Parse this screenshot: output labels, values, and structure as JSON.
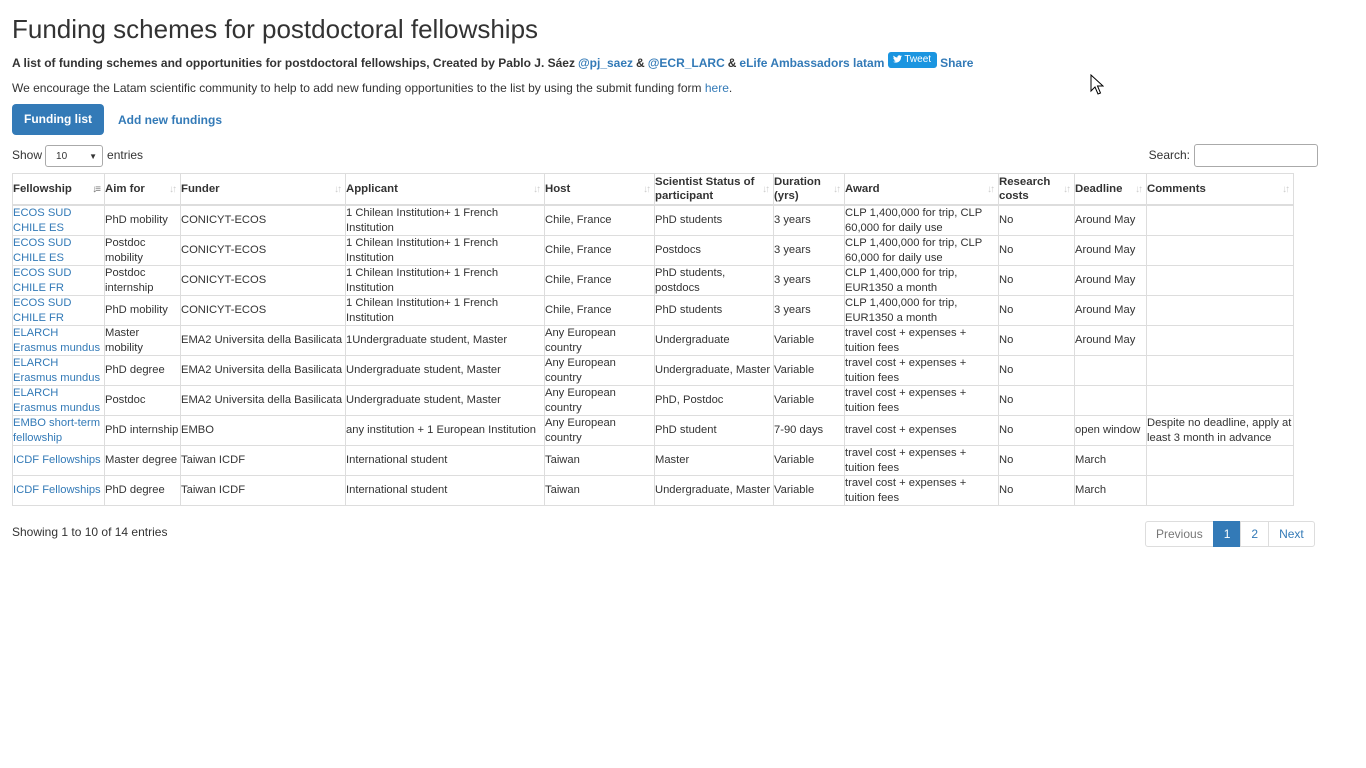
{
  "page": {
    "title": "Funding schemes for postdoctoral fellowships",
    "subtitle_text": "A list of funding schemes and opportunities for postdoctoral fellowships, Created by Pablo J. Sáez",
    "link_pj": "@pj_saez",
    "amp1": "&",
    "link_ecr": "@ECR_LARC",
    "amp2": "&",
    "link_elife": "eLife Ambassadors latam",
    "tweet_label": "Tweet",
    "share_label": "Share",
    "encourage_text": "We encourage the Latam scientific community to help to add new funding opportunities to the list by using the submit funding form",
    "encourage_link": "here",
    "encourage_end": "."
  },
  "tabs": {
    "active": "Funding list",
    "other": "Add new fundings"
  },
  "controls": {
    "show_label": "Show",
    "entries_value": "10",
    "entries_label": "entries",
    "search_label": "Search:"
  },
  "table": {
    "headers": [
      "Fellowship",
      "Aim for",
      "Funder",
      "Applicant",
      "Host",
      "Scientist Status of participant",
      "Duration (yrs)",
      "Award",
      "Research costs",
      "Deadline",
      "Comments"
    ],
    "rows": [
      [
        "ECOS SUD CHILE ES",
        "PhD mobility",
        "CONICYT-ECOS",
        "1 Chilean Institution+ 1 French Institution",
        "Chile, France",
        "PhD students",
        "3 years",
        "CLP 1,400,000 for trip, CLP 60,000 for daily use",
        "No",
        "Around May",
        ""
      ],
      [
        "ECOS SUD CHILE ES",
        "Postdoc mobility",
        "CONICYT-ECOS",
        "1 Chilean Institution+ 1 French Institution",
        "Chile, France",
        "Postdocs",
        "3 years",
        "CLP 1,400,000 for trip, CLP 60,000 for daily use",
        "No",
        "Around May",
        ""
      ],
      [
        "ECOS SUD CHILE FR",
        "Postdoc internship",
        "CONICYT-ECOS",
        "1 Chilean Institution+ 1 French Institution",
        "Chile, France",
        "PhD students, postdocs",
        "3 years",
        "CLP 1,400,000 for trip, EUR1350 a month",
        "No",
        "Around May",
        ""
      ],
      [
        "ECOS SUD CHILE FR",
        "PhD mobility",
        "CONICYT-ECOS",
        "1 Chilean Institution+ 1 French Institution",
        "Chile, France",
        "PhD students",
        "3 years",
        "CLP 1,400,000 for trip, EUR1350 a month",
        "No",
        "Around May",
        ""
      ],
      [
        "ELARCH Erasmus mundus",
        "Master mobility",
        "EMA2 Universita della Basilicata",
        "1Undergraduate student, Master",
        "Any European country",
        "Undergraduate",
        "Variable",
        "travel cost + expenses + tuition fees",
        "No",
        "Around May",
        ""
      ],
      [
        "ELARCH Erasmus mundus",
        "PhD degree",
        "EMA2 Universita della Basilicata",
        "Undergraduate student, Master",
        "Any European country",
        "Undergraduate, Master",
        "Variable",
        "travel cost + expenses + tuition fees",
        "No",
        "",
        ""
      ],
      [
        "ELARCH Erasmus mundus",
        "Postdoc",
        "EMA2 Universita della Basilicata",
        "Undergraduate student, Master",
        "Any European country",
        "PhD, Postdoc",
        "Variable",
        "travel cost + expenses + tuition fees",
        "No",
        "",
        ""
      ],
      [
        "EMBO short-term fellowship",
        "PhD internship",
        "EMBO",
        "any institution + 1 European Institution",
        "Any European country",
        "PhD student",
        "7-90 days",
        "travel cost + expenses",
        "No",
        "open window",
        "Despite no deadline, apply at least 3 month in advance"
      ],
      [
        "ICDF Fellowships",
        "Master degree",
        "Taiwan ICDF",
        "International student",
        "Taiwan",
        "Master",
        "Variable",
        "travel cost + expenses + tuition fees",
        "No",
        "March",
        ""
      ],
      [
        "ICDF Fellowships",
        "PhD degree",
        "Taiwan ICDF",
        "International student",
        "Taiwan",
        "Undergraduate, Master",
        "Variable",
        "travel cost + expenses + tuition fees",
        "No",
        "March",
        ""
      ]
    ]
  },
  "footer": {
    "info": "Showing 1 to 10 of 14 entries"
  },
  "pagination": {
    "previous": "Previous",
    "page1": "1",
    "page2": "2",
    "next": "Next"
  }
}
